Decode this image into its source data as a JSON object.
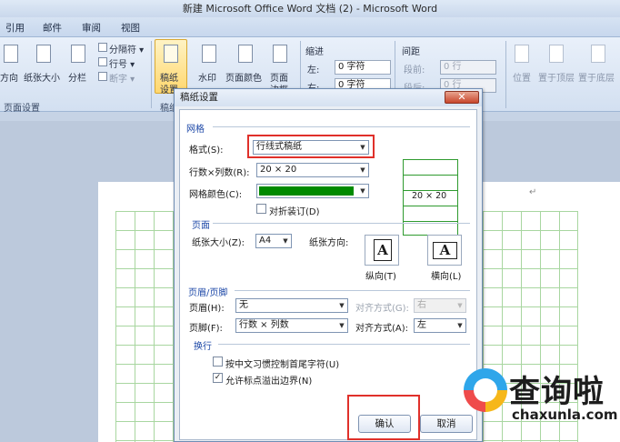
{
  "window": {
    "title": "新建 Microsoft Office Word 文档 (2) - Microsoft Word"
  },
  "tabs": [
    "引用",
    "邮件",
    "审阅",
    "视图"
  ],
  "ribbon": {
    "text_direction": "方向",
    "paper_size": "纸张大小",
    "columns": "分栏",
    "breaks": "分隔符 ▾",
    "line_numbers": "行号 ▾",
    "hyphenation": "断字 ▾",
    "draft_paper": "稿纸",
    "draft_paper_2": "设置",
    "watermark": "水印",
    "page_color": "页面颜色",
    "page_border": "页面",
    "page_border_2": "边框",
    "indent_title": "缩进",
    "indent_left_label": "左:",
    "indent_left_value": "0 字符",
    "indent_right_label": "右:",
    "indent_right_value": "0 字符",
    "spacing_title": "间距",
    "spacing_before_label": "段前:",
    "spacing_before_value": "0 行",
    "spacing_after_label": "段后:",
    "spacing_after_value": "0 行",
    "position": "位置",
    "bring_front": "置于顶层",
    "send_back": "置于底层",
    "group_page_setup": "页面设置",
    "group_draft": "稿纸"
  },
  "dialog": {
    "title": "稿纸设置",
    "close": "✕",
    "section_grid": "网格",
    "format_label": "格式(S):",
    "format_value": "行线式稿纸",
    "rows_cols_label": "行数×列数(R):",
    "rows_cols_value": "20 × 20",
    "grid_color_label": "网格颜色(C):",
    "grid_color_hex": "#008a00",
    "fold_label": "对折装订(D)",
    "fold_checked": false,
    "preview_text": "20 × 20",
    "section_page": "页面",
    "paper_size_label": "纸张大小(Z):",
    "paper_size_value": "A4",
    "orientation_label": "纸张方向:",
    "portrait_label": "纵向(T)",
    "landscape_label": "横向(L)",
    "section_header": "页眉/页脚",
    "header_label": "页眉(H):",
    "header_value": "无",
    "header_align_label": "对齐方式(G):",
    "header_align_value": "右",
    "footer_label": "页脚(F):",
    "footer_value": "行数 × 列数",
    "footer_align_label": "对齐方式(A):",
    "footer_align_value": "左",
    "section_wrap": "换行",
    "wrap_opt1_label": "按中文习惯控制首尾字符(U)",
    "wrap_opt1_checked": false,
    "wrap_opt2_label": "允许标点溢出边界(N)",
    "wrap_opt2_checked": true,
    "ok": "确认",
    "cancel": "取消"
  },
  "watermark_brand": {
    "name": "查询啦",
    "url": "chaxunla.com"
  }
}
